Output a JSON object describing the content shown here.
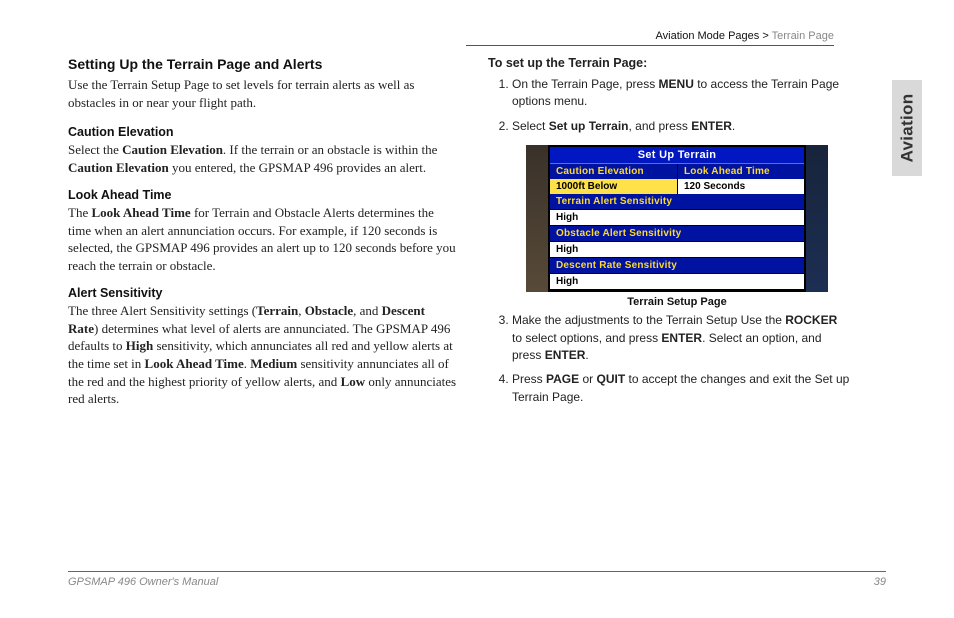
{
  "breadcrumb": {
    "part1": "Aviation Mode Pages > ",
    "part2": "Terrain Page"
  },
  "side_tab": "Aviation",
  "left": {
    "h2": "Setting Up the Terrain Page and Alerts",
    "intro": "Use the Terrain Setup Page to set levels for terrain alerts as well as obstacles in or near your flight path.",
    "caution_h": "Caution Elevation",
    "caution_p_1": "Select the ",
    "caution_b1": "Caution Elevation",
    "caution_p_2": ". If the terrain or an obstacle is within the ",
    "caution_b2": "Caution Elevation",
    "caution_p_3": " you entered, the GPSMAP 496 provides an alert.",
    "look_h": "Look Ahead Time",
    "look_p_1": "The ",
    "look_b1": "Look Ahead Time",
    "look_p_2": " for Terrain and Obstacle Alerts determines the time when an alert annunciation occurs. For example, if 120 seconds is selected, the GPSMAP 496 provides an alert up to 120 seconds before you reach the terrain or obstacle.",
    "sens_h": "Alert Sensitivity",
    "sens_p_1": "The three Alert Sensitivity settings (",
    "sens_b1": "Terrain",
    "sens_p_2": ", ",
    "sens_b2": "Obstacle",
    "sens_p_3": ", and ",
    "sens_b3": "Descent Rate",
    "sens_p_4": ") determines what level of alerts are annunciated. The GPSMAP 496 defaults to ",
    "sens_b4": "High",
    "sens_p_5": " sensitivity, which annunciates all red and yellow alerts at the time set in ",
    "sens_b5": "Look Ahead Time",
    "sens_p_6": ". ",
    "sens_b6": "Medium",
    "sens_p_7": " sensitivity annunciates all of the red and the highest priority of yellow alerts, and ",
    "sens_b7": "Low",
    "sens_p_8": " only annunciates red alerts."
  },
  "right": {
    "lead": "To set up the Terrain Page:",
    "s1_a": "On the Terrain Page, press ",
    "s1_b1": "MENU",
    "s1_b": " to access the Terrain Page options menu.",
    "s2_a": "Select ",
    "s2_b1": "Set up Terrain",
    "s2_b": ", and press ",
    "s2_b2": "ENTER",
    "s2_c": ".",
    "s3_a": "Make the adjustments to the Terrain Setup Use the ",
    "s3_b1": "ROCKER",
    "s3_b": " to select options, and press ",
    "s3_b2": "ENTER",
    "s3_c": ". Select an option, and press ",
    "s3_b3": "ENTER",
    "s3_d": ".",
    "s4_a": "Press ",
    "s4_b1": "PAGE",
    "s4_b": " or ",
    "s4_b2": "QUIT",
    "s4_c": " to accept the changes and exit the Set up Terrain Page.",
    "caption": "Terrain Setup Page"
  },
  "device": {
    "title": "Set Up Terrain",
    "h_caution": "Caution Elevation",
    "h_look": "Look Ahead Time",
    "v_caution": "1000ft Below",
    "v_look": "120 Seconds",
    "h_terr": "Terrain Alert Sensitivity",
    "v_terr": "High",
    "h_obs": "Obstacle Alert Sensitivity",
    "v_obs": "High",
    "h_desc": "Descent Rate Sensitivity",
    "v_desc": "High"
  },
  "footer": {
    "left": "GPSMAP 496 Owner's Manual",
    "right": "39"
  }
}
